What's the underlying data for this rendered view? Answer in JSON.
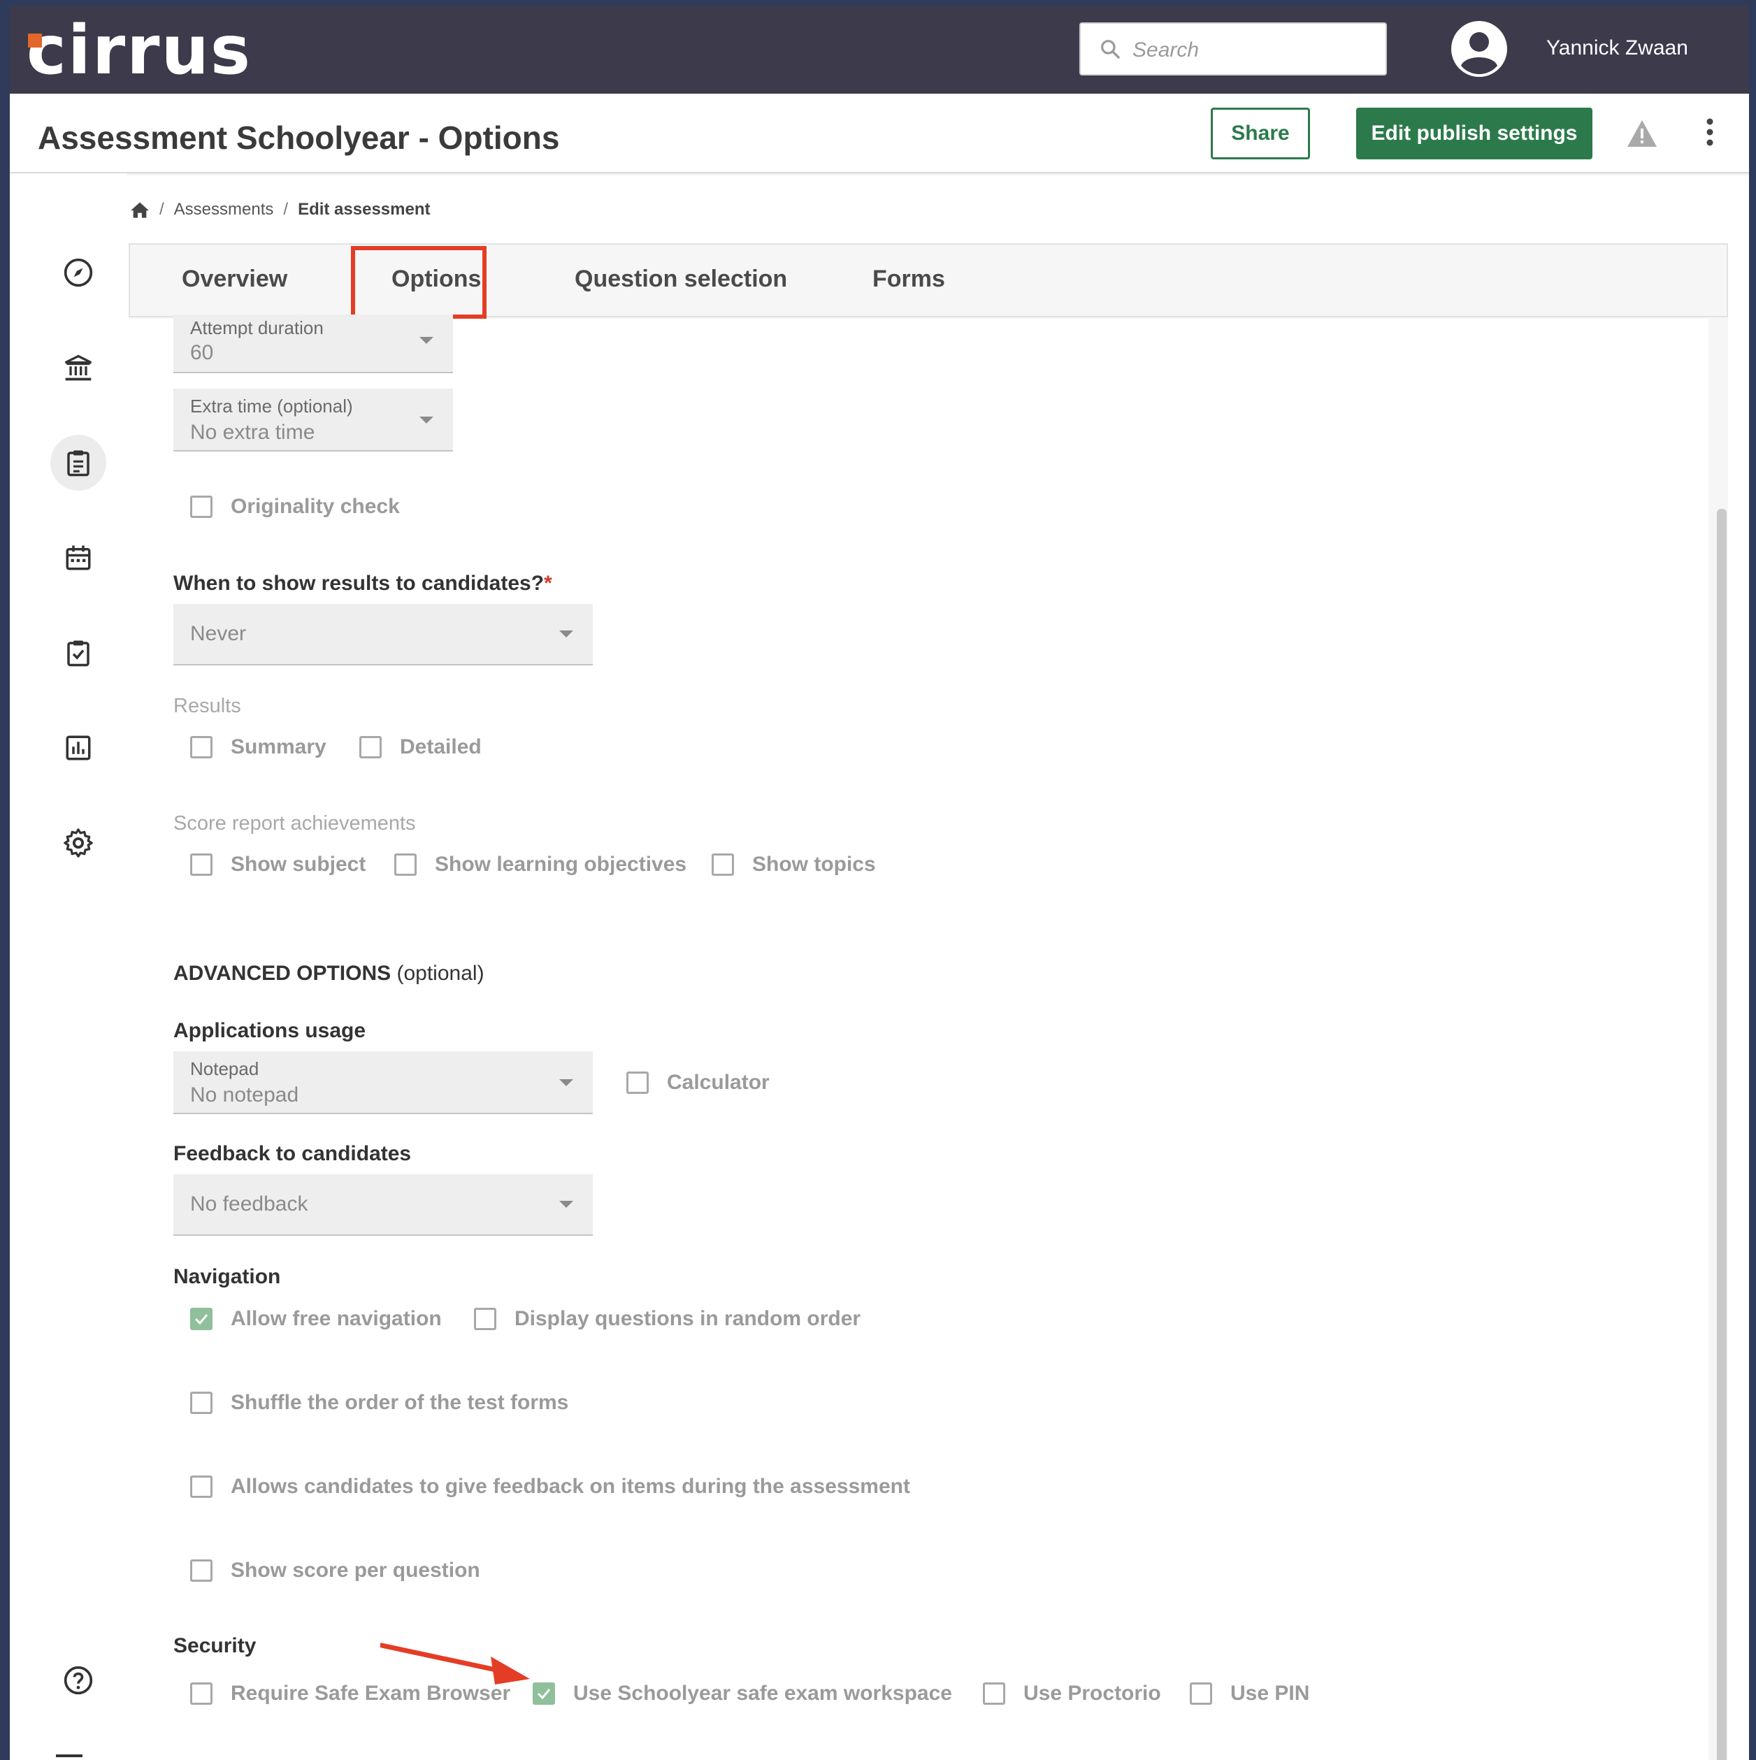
{
  "app": {
    "logo_text": "cirrus"
  },
  "header": {
    "search_placeholder": "Search",
    "user_name": "Yannick Zwaan"
  },
  "titlebar": {
    "title": "Assessment Schoolyear - Options",
    "share_label": "Share",
    "publish_label": "Edit publish settings"
  },
  "breadcrumb": {
    "items": [
      "Assessments",
      "Edit assessment"
    ],
    "separator": "/"
  },
  "tabs": [
    {
      "label": "Overview"
    },
    {
      "label": "Options",
      "selected": true
    },
    {
      "label": "Question selection"
    },
    {
      "label": "Forms"
    }
  ],
  "form": {
    "attempt_duration": {
      "label": "Attempt duration",
      "value": "60"
    },
    "extra_time": {
      "label": "Extra time (optional)",
      "value": "No extra time"
    },
    "originality_check": {
      "label": "Originality check",
      "checked": false
    },
    "show_results": {
      "label": "When to show results to candidates?",
      "required_mark": "*",
      "value": "Never"
    },
    "results": {
      "label": "Results",
      "options": [
        {
          "label": "Summary",
          "checked": false
        },
        {
          "label": "Detailed",
          "checked": false
        }
      ]
    },
    "score_report": {
      "label": "Score report achievements",
      "options": [
        {
          "label": "Show subject",
          "checked": false
        },
        {
          "label": "Show learning objectives",
          "checked": false
        },
        {
          "label": "Show topics",
          "checked": false
        }
      ]
    },
    "advanced": {
      "title": "ADVANCED OPTIONS",
      "suffix": "(optional)"
    },
    "applications_usage": {
      "label": "Applications usage",
      "notepad": {
        "label": "Notepad",
        "value": "No notepad"
      },
      "calculator": {
        "label": "Calculator",
        "checked": false
      }
    },
    "feedback": {
      "label": "Feedback to candidates",
      "value": "No feedback"
    },
    "navigation": {
      "label": "Navigation",
      "allow_free": {
        "label": "Allow free navigation",
        "checked": true
      },
      "random_order": {
        "label": "Display questions in random order",
        "checked": false
      },
      "shuffle_forms": {
        "label": "Shuffle the order of the test forms",
        "checked": false
      },
      "item_feedback": {
        "label": "Allows candidates to give feedback on items during the assessment",
        "checked": false
      },
      "score_per_question": {
        "label": "Show score per question",
        "checked": false
      }
    },
    "security": {
      "label": "Security",
      "options": [
        {
          "label": "Require Safe Exam Browser",
          "checked": false
        },
        {
          "label": "Use Schoolyear safe exam workspace",
          "checked": true
        },
        {
          "label": "Use Proctorio",
          "checked": false
        },
        {
          "label": "Use PIN",
          "checked": false
        }
      ]
    }
  },
  "colors": {
    "topbar": "#3c3a4b",
    "brand_green": "#2c7a4b",
    "logo_accent": "#e2672a",
    "highlight_red": "#e43d26",
    "check_green": "#8fbf9b"
  },
  "icons": [
    "compass-icon",
    "institution-icon",
    "clipboard-icon",
    "calendar-icon",
    "task-check-icon",
    "chart-icon",
    "gear-icon",
    "help-icon",
    "home-icon",
    "search-icon",
    "user-icon",
    "warning-icon",
    "more-vert-icon",
    "checkmark-icon",
    "arrow-annotation"
  ]
}
